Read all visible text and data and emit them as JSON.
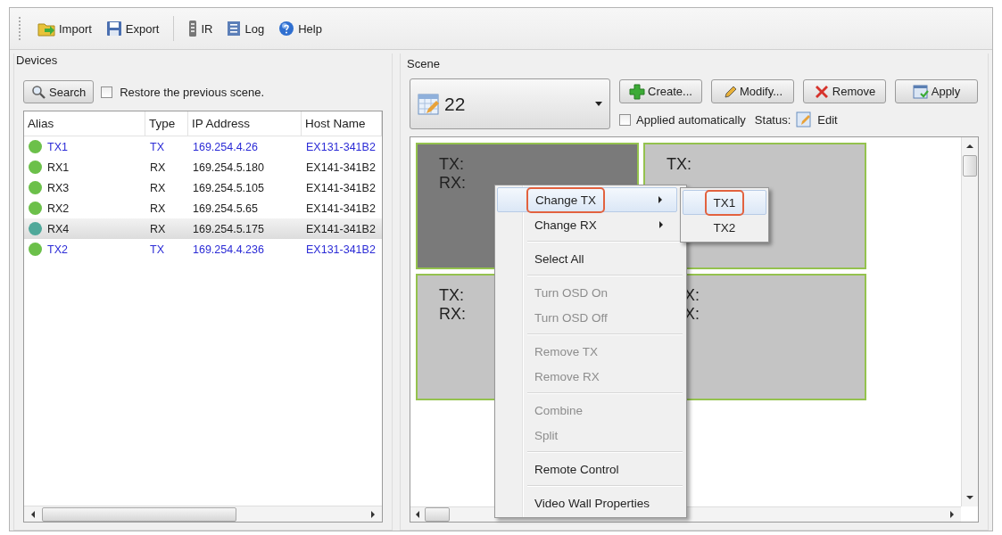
{
  "toolbar": {
    "items": [
      {
        "kind": "import",
        "label": "Import"
      },
      {
        "kind": "export",
        "label": "Export"
      },
      {
        "kind": "ir",
        "label": "IR"
      },
      {
        "kind": "log",
        "label": "Log"
      },
      {
        "kind": "help",
        "label": "Help"
      }
    ]
  },
  "devices": {
    "title": "Devices",
    "search_button": "Search",
    "restore": {
      "label": "Restore the previous scene.",
      "checked": false
    },
    "table": {
      "columns": [
        "Alias",
        "Type",
        "IP Address",
        "Host Name"
      ],
      "rows": [
        {
          "alias": "TX1",
          "type": "TX",
          "kind": "tx",
          "ip": "169.254.4.26",
          "host": "EX131-341B2",
          "color": "#6cc04a",
          "selected": false
        },
        {
          "alias": "RX1",
          "type": "RX",
          "kind": "rx",
          "ip": "169.254.5.180",
          "host": "EX141-341B2",
          "color": "#6cc04a",
          "selected": false
        },
        {
          "alias": "RX3",
          "type": "RX",
          "kind": "rx",
          "ip": "169.254.5.105",
          "host": "EX141-341B2",
          "color": "#6cc04a",
          "selected": false
        },
        {
          "alias": "RX2",
          "type": "RX",
          "kind": "rx",
          "ip": "169.254.5.65",
          "host": "EX141-341B2",
          "color": "#6cc04a",
          "selected": false
        },
        {
          "alias": "RX4",
          "type": "RX",
          "kind": "rx",
          "ip": "169.254.5.175",
          "host": "EX141-341B2",
          "color": "#4fa89a",
          "selected": true
        },
        {
          "alias": "TX2",
          "type": "TX",
          "kind": "tx",
          "ip": "169.254.4.236",
          "host": "EX131-341B2",
          "color": "#6cc04a",
          "selected": false
        }
      ]
    }
  },
  "scene": {
    "title": "Scene",
    "dropdown": {
      "value": "22"
    },
    "buttons": [
      {
        "kind": "create",
        "label": "Create..."
      },
      {
        "kind": "modify",
        "label": "Modify..."
      },
      {
        "kind": "remove",
        "label": "Remove"
      },
      {
        "kind": "apply",
        "label": "Apply"
      }
    ],
    "auto_apply": {
      "label": "Applied automatically",
      "checked": false
    },
    "status_label": "Status:",
    "status_value": "Edit",
    "tiles": [
      {
        "selected": true,
        "lines": [
          "TX:",
          "RX:"
        ]
      },
      {
        "selected": false,
        "lines": [
          "TX:"
        ]
      },
      {
        "selected": false,
        "lines": [
          "TX:",
          "RX:"
        ]
      },
      {
        "selected": false,
        "lines": [
          "X:",
          "X:"
        ]
      }
    ]
  },
  "context_menu": {
    "groups": [
      [
        {
          "label": "Change TX",
          "disabled": false,
          "hovered": true,
          "submenu": true,
          "annotated": true
        },
        {
          "label": "Change RX",
          "disabled": false,
          "hovered": false,
          "submenu": true,
          "annotated": false
        }
      ],
      [
        {
          "label": "Select All",
          "disabled": false,
          "hovered": false,
          "submenu": false,
          "annotated": false
        }
      ],
      [
        {
          "label": "Turn OSD On",
          "disabled": true,
          "hovered": false,
          "submenu": false,
          "annotated": false
        },
        {
          "label": "Turn OSD Off",
          "disabled": true,
          "hovered": false,
          "submenu": false,
          "annotated": false
        }
      ],
      [
        {
          "label": "Remove TX",
          "disabled": true,
          "hovered": false,
          "submenu": false,
          "annotated": false
        },
        {
          "label": "Remove RX",
          "disabled": true,
          "hovered": false,
          "submenu": false,
          "annotated": false
        }
      ],
      [
        {
          "label": "Combine",
          "disabled": true,
          "hovered": false,
          "submenu": false,
          "annotated": false
        },
        {
          "label": "Split",
          "disabled": true,
          "hovered": false,
          "submenu": false,
          "annotated": false
        }
      ],
      [
        {
          "label": "Remote Control",
          "disabled": false,
          "hovered": false,
          "submenu": false,
          "annotated": false
        }
      ],
      [
        {
          "label": "Video Wall Properties",
          "disabled": false,
          "hovered": false,
          "submenu": false,
          "annotated": false
        }
      ]
    ],
    "submenu": {
      "items": [
        {
          "label": "TX1",
          "hovered": true,
          "annotated": true
        },
        {
          "label": "TX2",
          "hovered": false,
          "annotated": false
        }
      ]
    }
  }
}
